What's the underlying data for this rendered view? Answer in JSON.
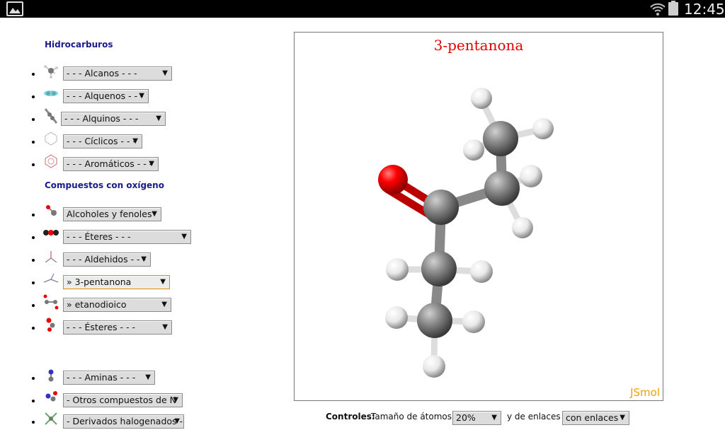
{
  "statusbar": {
    "time": "12:45",
    "icons": [
      "gallery-icon",
      "wifi-icon",
      "battery-icon"
    ]
  },
  "sections": {
    "hydrocarbons": "Hidrocarburos",
    "oxygen": "Compuestos con oxígeno"
  },
  "selects": {
    "alcanos": "- - - Alcanos - - -",
    "alquenos": "- - - Alquenos - - -",
    "alquinos": "- - - Alquinos - - -",
    "ciclicos": "- - - Cíclicos - - -",
    "aromaticos": "- - - Aromáticos - - -",
    "alcoholes": "Alcoholes y fenoles",
    "eteres": "- - - Éteres - - -",
    "aldehidos": "- - - Aldehidos - - -",
    "cetonas": "» 3-pentanona",
    "acidos": "» etanodioico",
    "esteres": "- - - Ésteres - - -",
    "aminas": "- - - Aminas - - -",
    "otros_n": "- Otros compuestos de N",
    "halogenados": "- Derivados halogenados -"
  },
  "viewer": {
    "title": "3-pentanona",
    "brand": "JSmol",
    "colors": {
      "oxygen": "#ff0000",
      "carbon": "#808080",
      "hydrogen": "#f0f0f0"
    }
  },
  "controls": {
    "label": "Controles:",
    "atom_size_label": "Tamaño de átomos",
    "atom_size_value": "20%",
    "bonds_label": "y de enlaces",
    "bonds_value": "con enlaces"
  }
}
